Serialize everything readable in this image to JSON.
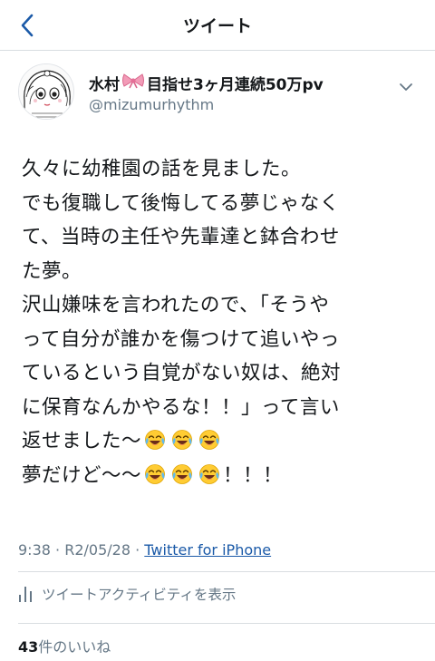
{
  "nav": {
    "back_icon": "chevron-left-icon",
    "title": "ツイート"
  },
  "author": {
    "name_prefix": "水村",
    "name_emoji": "🎀",
    "name_suffix": "目指せ3ヶ月連続50万pv",
    "handle": "@mizumurhythm",
    "avatar": "avatar-illustration",
    "menu_icon": "chevron-down-icon"
  },
  "tweet": {
    "lines": [
      "久々に幼稚園の話を見ました。",
      "でも復職して後悔してる夢じゃなく",
      "て、当時の主任や先輩達と鉢合わせ",
      "た夢。",
      "沢山嫌味を言われたので、「そうや",
      "って自分が誰かを傷つけて追いやっ",
      "ているという自覚がない奴は、絶対",
      "に保育なんかやるな！！」って言い"
    ],
    "line9_text": "返せました〜",
    "line9_emoji": "😂😂😂",
    "line10_text": "夢だけど〜〜",
    "line10_emoji": "😂😂😂",
    "line10_end": "！！！"
  },
  "meta": {
    "time": "9:38",
    "separator": "·",
    "date": "R2/05/28",
    "source": "Twitter for iPhone"
  },
  "activity": {
    "icon": "bar-chart-icon",
    "label": "ツイートアクティビティを表示"
  },
  "likes": {
    "count": "43",
    "label": "件のいいね"
  },
  "colors": {
    "text": "#14171a",
    "secondary": "#657786",
    "accent": "#1b5aa8",
    "divider": "#d9dde1"
  }
}
